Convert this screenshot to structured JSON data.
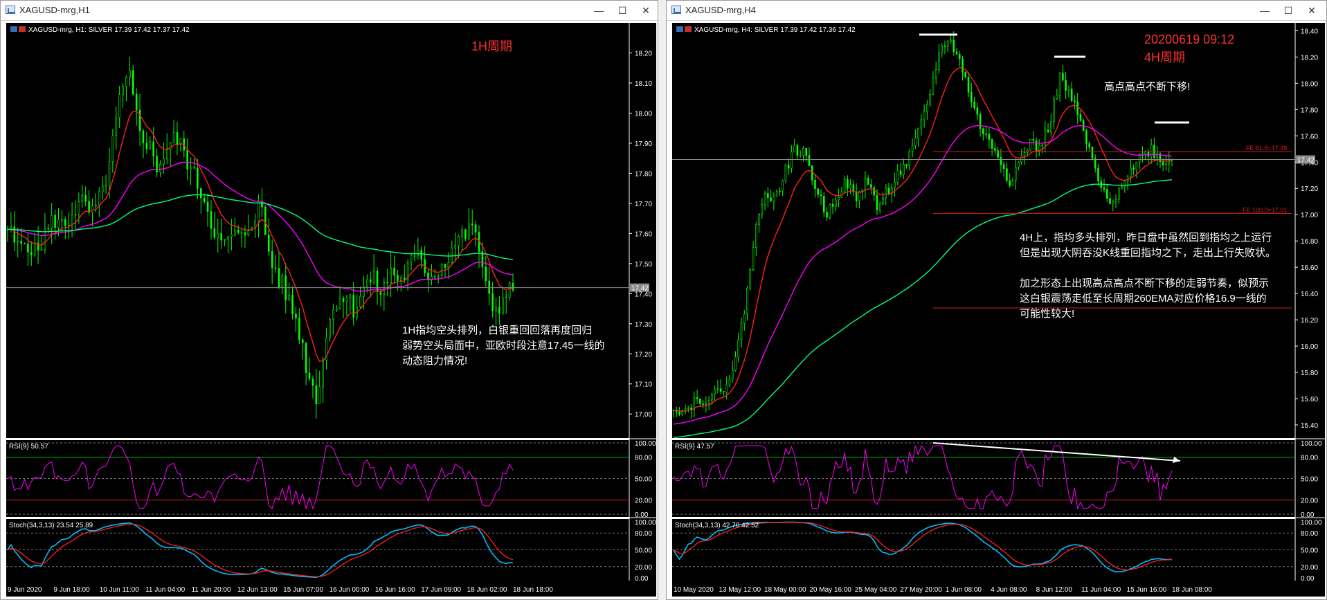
{
  "windows": [
    {
      "title": "XAGUSD-mrg,H1",
      "buttons": {
        "minimize": "—",
        "maximize": "☐",
        "close": "✕"
      },
      "info_line": "XAGUSD-mrg, H1:  SILVER  17.39 17.42 17.37 17.42",
      "period_label": "1H周期",
      "annotation": [
        "1H指均空头排列，白银重回回落再度回归",
        "弱势空头局面中，亚欧时段注意17.45一线的",
        "动态阻力情况!"
      ],
      "price_axis": [
        "18.20",
        "18.10",
        "18.00",
        "17.90",
        "17.80",
        "17.70",
        "17.60",
        "17.50",
        "17.40",
        "17.30",
        "17.20",
        "17.10",
        "17.00"
      ],
      "current_price": "17.42",
      "rsi_label": "RSI(9) 50.57",
      "rsi_axis": [
        "100.00",
        "80.00",
        "50.00",
        "20.00",
        "0.00"
      ],
      "stoch_label": "Stoch(34,3,13) 23.54 25.89",
      "stoch_axis": [
        "100.00",
        "80.00",
        "50.00",
        "20.00",
        "0.00"
      ],
      "time_axis": [
        "9 Jun 2020",
        "9 Jun 18:00",
        "10 Jun 11:00",
        "11 Jun 04:00",
        "11 Jun 20:00",
        "12 Jun 13:00",
        "15 Jun 07:00",
        "16 Jun 00:00",
        "16 Jun 16:00",
        "17 Jun 09:00",
        "18 Jun 02:00",
        "18 Jun 18:00"
      ]
    },
    {
      "title": "XAGUSD-mrg,H4",
      "buttons": {
        "minimize": "—",
        "maximize": "☐",
        "close": "✕"
      },
      "info_line": "XAGUSD-mrg, H4:  SILVER  17.39 17.42 17.36 17.42",
      "date_label": "20200619 09:12",
      "period_label": "4H周期",
      "note_top": "高点高点不断下移!",
      "annotation": [
        "4H上，指均多头排列，昨日盘中虽然回到指均之上运行",
        "但是出现大阴吞没K线重回指均之下，走出上行失败状。",
        "",
        "加之形态上出现高点高点不断下移的走弱节奏，似预示",
        "这白银震荡走低至长周期260EMA对应价格16.9一线的",
        "可能性较大!"
      ],
      "fe_labels": [
        "FE 61.8=17.48",
        "FE 100.0=17.01"
      ],
      "price_axis": [
        "18.40",
        "18.20",
        "18.00",
        "17.80",
        "17.60",
        "17.40",
        "17.20",
        "17.00",
        "16.80",
        "16.60",
        "16.40",
        "16.20",
        "16.00",
        "15.80",
        "15.60",
        "15.40"
      ],
      "current_price": "17.42",
      "rsi_label": "RSI(9) 47.57",
      "rsi_axis": [
        "100.00",
        "80.00",
        "50.00",
        "20.00",
        "0.00"
      ],
      "stoch_label": "Stoch(34,3,13) 42.70 42.52",
      "stoch_axis": [
        "100.00",
        "80.00",
        "50.00",
        "20.00",
        "0.00"
      ],
      "time_axis": [
        "10 May 2020",
        "13 May 12:00",
        "18 May 00:00",
        "20 May 16:00",
        "25 May 04:00",
        "27 May 20:00",
        "1 Jun 08:00",
        "4 Jun 08:00",
        "8 Jun 12:00",
        "11 Jun 04:00",
        "15 Jun 16:00",
        "18 Jun 08:00"
      ]
    }
  ],
  "chart_data": [
    {
      "type": "candlestick",
      "title": "XAGUSD-mrg,H1",
      "ylim": [
        16.92,
        18.3
      ],
      "series": [
        {
          "name": "price",
          "color": "#00ff00",
          "values": [
            17.62,
            17.55,
            17.58,
            17.53,
            17.6,
            17.65,
            17.62,
            17.68,
            17.7,
            17.66,
            17.72,
            17.85,
            18.05,
            18.12,
            17.95,
            17.9,
            17.82,
            17.88,
            17.92,
            17.86,
            17.78,
            17.72,
            17.62,
            17.55,
            17.6,
            17.58,
            17.64,
            17.7,
            17.52,
            17.45,
            17.38,
            17.3,
            17.15,
            17.05,
            17.25,
            17.38,
            17.4,
            17.35,
            17.42,
            17.45,
            17.4,
            17.48,
            17.44,
            17.5,
            17.52,
            17.46,
            17.48,
            17.52,
            17.58,
            17.6,
            17.62,
            17.42,
            17.35,
            17.38,
            17.42
          ]
        },
        {
          "name": "EMA fast",
          "color": "#ff2020"
        },
        {
          "name": "EMA mid",
          "color": "#ff00ff"
        },
        {
          "name": "EMA slow",
          "color": "#00ff7f"
        }
      ],
      "x_labels": [
        "9 Jun 2020",
        "9 Jun 18:00",
        "10 Jun 11:00",
        "11 Jun 04:00",
        "11 Jun 20:00",
        "12 Jun 13:00",
        "15 Jun 07:00",
        "16 Jun 00:00",
        "16 Jun 16:00",
        "17 Jun 09:00",
        "18 Jun 02:00",
        "18 Jun 18:00"
      ]
    },
    {
      "type": "candlestick",
      "title": "XAGUSD-mrg,H4",
      "ylim": [
        15.3,
        18.46
      ],
      "series": [
        {
          "name": "price",
          "color": "#00ff00",
          "values": [
            15.55,
            15.5,
            15.58,
            15.6,
            15.62,
            15.7,
            15.85,
            16.3,
            16.85,
            17.2,
            17.1,
            17.35,
            17.5,
            17.45,
            17.2,
            17.0,
            17.15,
            17.25,
            17.1,
            17.3,
            17.05,
            17.18,
            17.3,
            17.4,
            17.6,
            17.85,
            18.2,
            18.35,
            18.2,
            17.95,
            17.7,
            17.55,
            17.45,
            17.25,
            17.4,
            17.55,
            17.5,
            17.7,
            18.05,
            17.9,
            17.7,
            17.45,
            17.2,
            17.05,
            17.25,
            17.35,
            17.45,
            17.5,
            17.4,
            17.42
          ]
        },
        {
          "name": "EMA fast",
          "color": "#ff2020"
        },
        {
          "name": "EMA mid",
          "color": "#ff00ff"
        },
        {
          "name": "EMA slow",
          "color": "#00ff7f"
        }
      ],
      "fibonacci": [
        17.48,
        17.01
      ],
      "x_labels": [
        "10 May 2020",
        "13 May 12:00",
        "18 May 00:00",
        "20 May 16:00",
        "25 May 04:00",
        "27 May 20:00",
        "1 Jun 08:00",
        "4 Jun 08:00",
        "8 Jun 12:00",
        "11 Jun 04:00",
        "15 Jun 16:00",
        "18 Jun 08:00"
      ]
    }
  ],
  "colors": {
    "background": "#000000",
    "candle": "#00ff00",
    "ema_fast": "#ff2020",
    "ema_mid": "#ff00ff",
    "ema_slow": "#00ff7f",
    "rsi": "#ff00ff",
    "stoch_main": "#00bfff",
    "stoch_signal": "#ff2020",
    "annotation_red": "#ff3030"
  }
}
